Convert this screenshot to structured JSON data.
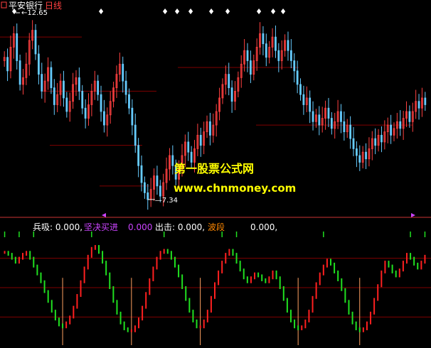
{
  "header": {
    "stock_name": "平安银行",
    "period": "日线"
  },
  "watermark": {
    "line1": "第一股票公式网",
    "line2": "www.chnmoney.com"
  },
  "indicator_bar": {
    "item1": "兵吸: 0.000,",
    "item2": "坚决买进",
    "item2_value": "0.000",
    "item3": "出击: 0.000,",
    "item4": "波段",
    "item4_value": "0.000,"
  },
  "colors": {
    "background": "#000000",
    "up": "#ff4040",
    "down": "#66ccff",
    "indicator_up": "#ff2020",
    "indicator_down": "#20e020",
    "signal_line": "#ffa060",
    "level_line": "#800000",
    "watermark1": "#ffff00",
    "watermark2": "#ffff00",
    "label_white": "#ffffff",
    "label_purple": "#cc44ff",
    "label_orange": "#ff8800"
  },
  "chart_data": [
    {
      "type": "candlestick",
      "title": "平安银行 日线",
      "annotations": [
        {
          "label": "12.65",
          "kind": "high_marker"
        },
        {
          "label": "7.34",
          "kind": "low_marker"
        }
      ],
      "ylim": [
        7.0,
        13.0
      ],
      "close": [
        11.6,
        11.2,
        11.9,
        12.3,
        11.5,
        10.8,
        11.0,
        11.4,
        12.1,
        12.4,
        11.7,
        11.1,
        10.6,
        10.9,
        11.3,
        10.7,
        10.2,
        10.5,
        10.9,
        10.4,
        10.0,
        10.3,
        10.8,
        11.0,
        10.6,
        10.1,
        9.8,
        10.2,
        10.6,
        10.9,
        10.5,
        10.0,
        9.6,
        9.9,
        10.3,
        10.7,
        11.1,
        11.4,
        10.9,
        10.5,
        10.1,
        9.6,
        9.0,
        8.4,
        7.9,
        7.6,
        7.4,
        7.7,
        8.1,
        7.8,
        7.5,
        7.9,
        8.3,
        8.7,
        8.4,
        8.0,
        8.3,
        8.7,
        9.1,
        8.8,
        8.5,
        8.9,
        9.3,
        9.0,
        9.4,
        9.7,
        9.3,
        9.6,
        10.0,
        10.4,
        10.8,
        11.1,
        10.7,
        10.3,
        10.6,
        11.0,
        11.4,
        11.8,
        11.5,
        11.1,
        11.5,
        11.9,
        12.3,
        12.0,
        11.6,
        11.9,
        12.2,
        11.8,
        11.5,
        11.8,
        12.1,
        11.8,
        11.5,
        11.2,
        10.8,
        10.5,
        10.2,
        10.4,
        10.0,
        9.7,
        9.9,
        9.6,
        9.8,
        10.1,
        9.8,
        9.5,
        9.7,
        10.0,
        9.7,
        9.4,
        9.6,
        9.2,
        8.9,
        8.7,
        8.5,
        8.8,
        8.6,
        8.9,
        9.2,
        9.0,
        9.3,
        9.1,
        9.4,
        9.6,
        9.3,
        9.5,
        9.7,
        9.5,
        9.8,
        10.0,
        9.7,
        10.0,
        10.3,
        10.1,
        10.4,
        10.2
      ]
    },
    {
      "type": "bar",
      "title": "波段",
      "series": [
        {
          "name": "波段",
          "values": [
            0.86,
            0.84,
            0.8,
            0.76,
            0.8,
            0.84,
            0.86,
            0.8,
            0.72,
            0.64,
            0.56,
            0.46,
            0.36,
            0.26,
            0.18,
            0.12,
            0.1,
            0.14,
            0.2,
            0.3,
            0.42,
            0.56,
            0.7,
            0.82,
            0.9,
            0.92,
            0.86,
            0.76,
            0.64,
            0.5,
            0.36,
            0.24,
            0.14,
            0.08,
            0.06,
            0.06,
            0.1,
            0.18,
            0.3,
            0.44,
            0.58,
            0.7,
            0.8,
            0.86,
            0.88,
            0.86,
            0.8,
            0.72,
            0.62,
            0.5,
            0.38,
            0.26,
            0.16,
            0.1,
            0.1,
            0.16,
            0.26,
            0.4,
            0.54,
            0.66,
            0.76,
            0.84,
            0.88,
            0.84,
            0.76,
            0.68,
            0.6,
            0.56,
            0.6,
            0.64,
            0.62,
            0.58,
            0.56,
            0.6,
            0.66,
            0.6,
            0.5,
            0.38,
            0.26,
            0.16,
            0.1,
            0.08,
            0.1,
            0.16,
            0.26,
            0.4,
            0.54,
            0.64,
            0.72,
            0.78,
            0.74,
            0.66,
            0.58,
            0.48,
            0.36,
            0.24,
            0.14,
            0.08,
            0.06,
            0.08,
            0.14,
            0.24,
            0.38,
            0.52,
            0.66,
            0.76,
            0.72,
            0.66,
            0.62,
            0.68,
            0.76,
            0.84,
            0.8,
            0.74,
            0.7,
            0.76,
            0.82
          ]
        }
      ],
      "ylim": [
        0,
        1
      ]
    }
  ]
}
